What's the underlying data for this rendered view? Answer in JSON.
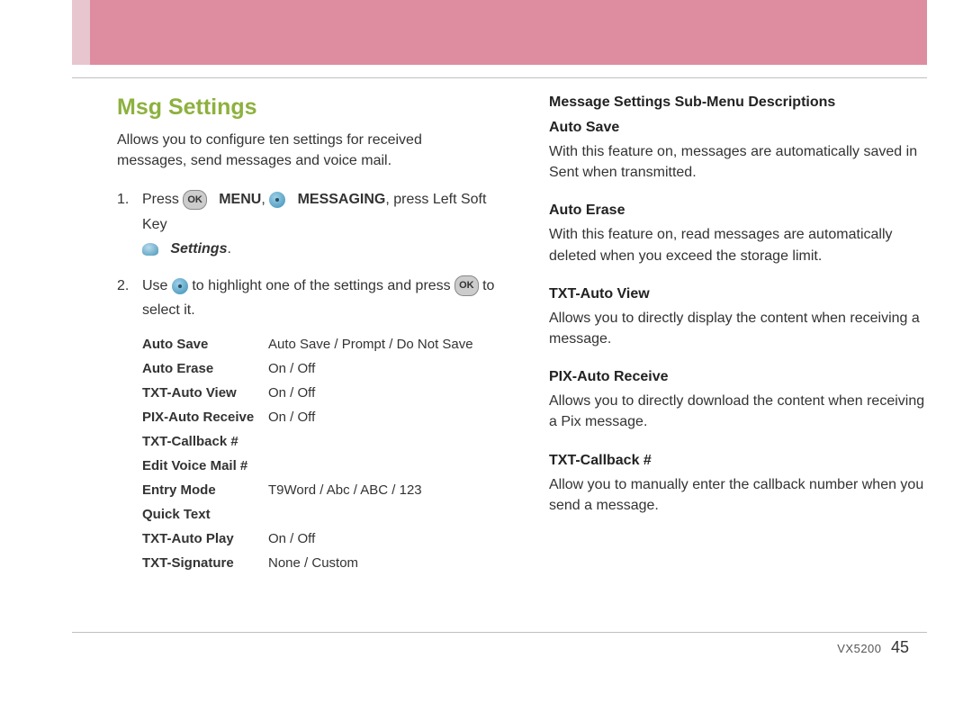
{
  "section_title": "Msg Settings",
  "intro": "Allows you to configure ten settings for received messages, send messages and voice mail.",
  "steps": {
    "s1": {
      "num": "1.",
      "press": "Press ",
      "menu": "MENU",
      "comma_sp": ", ",
      "messaging": "MESSAGING",
      "rest": ", press Left Soft Key",
      "settings_label": "Settings",
      "period": "."
    },
    "s2": {
      "num": "2.",
      "use": "Use ",
      "mid": " to highlight one of the settings and press ",
      "end": " to select it."
    }
  },
  "settings": [
    {
      "label": "Auto Save",
      "value": "Auto Save / Prompt / Do Not Save"
    },
    {
      "label": "Auto Erase",
      "value": "On / Off"
    },
    {
      "label": "TXT-Auto View",
      "value": "On / Off"
    },
    {
      "label": "PIX-Auto Receive",
      "value": "On / Off"
    },
    {
      "label": "TXT-Callback #",
      "value": ""
    },
    {
      "label": "Edit Voice Mail #",
      "value": ""
    },
    {
      "label": "Entry Mode",
      "value": "T9Word / Abc / ABC / 123"
    },
    {
      "label": "Quick Text",
      "value": ""
    },
    {
      "label": "TXT-Auto Play",
      "value": "On / Off"
    },
    {
      "label": "TXT-Signature",
      "value": "None / Custom"
    }
  ],
  "right_heading": "Message Settings Sub-Menu Descriptions",
  "descriptions": [
    {
      "title": "Auto Save",
      "text": "With this feature on, messages are automatically saved in Sent when transmitted."
    },
    {
      "title": "Auto Erase",
      "text": "With this feature on, read messages are automatically deleted when you exceed the storage limit."
    },
    {
      "title": "TXT-Auto View",
      "text": "Allows you to directly display the content when receiving a message."
    },
    {
      "title": "PIX-Auto Receive",
      "text": "Allows you to directly download the content when receiving a Pix message."
    },
    {
      "title": "TXT-Callback #",
      "text": "Allow you to manually enter the callback number when you send a message."
    }
  ],
  "footer": {
    "model": "VX5200",
    "page": "45"
  },
  "ok_label": "OK"
}
